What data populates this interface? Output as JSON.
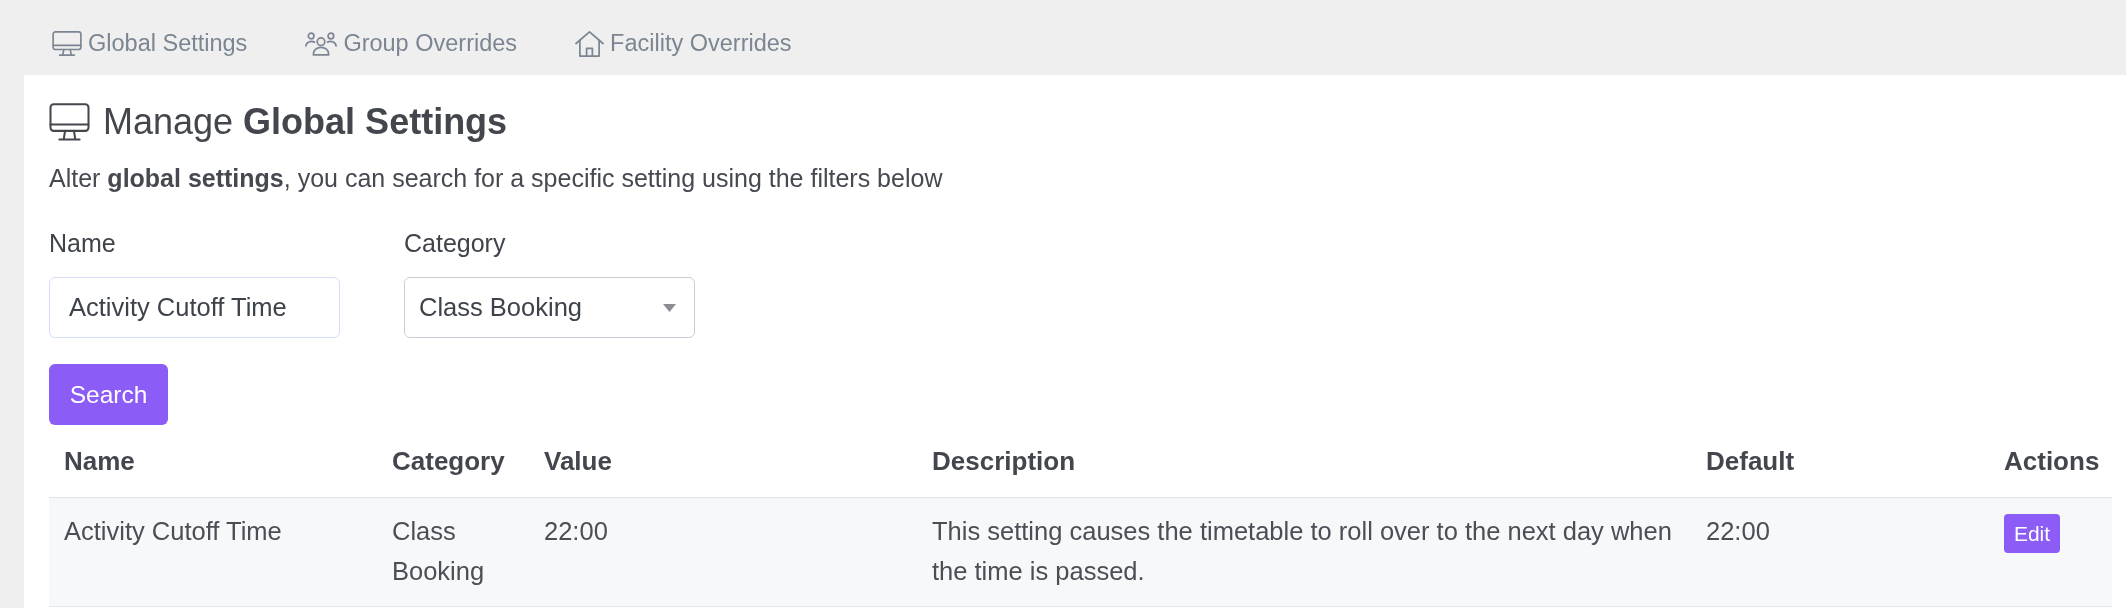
{
  "tabs": [
    {
      "label": "Global Settings"
    },
    {
      "label": "Group Overrides"
    },
    {
      "label": "Facility Overrides"
    }
  ],
  "header": {
    "title": "Manage **Global Settings**",
    "subtitle": "Alter **global settings**, you can search for a specific setting using the filters below"
  },
  "filters": {
    "name": {
      "label": "Name",
      "value": "Activity Cutoff Time"
    },
    "category": {
      "label": "Category",
      "value": "Class Booking"
    },
    "search_button": "Search"
  },
  "table": {
    "columns": [
      "Name",
      "Category",
      "Value",
      "Description",
      "Default",
      "Actions"
    ],
    "rows": [
      {
        "cells": [
          "Activity Cutoff Time",
          "Class Booking",
          "22:00",
          "This setting causes the timetable to roll over to the next day when the time is passed.",
          "22:00"
        ],
        "action": "Edit"
      }
    ]
  }
}
